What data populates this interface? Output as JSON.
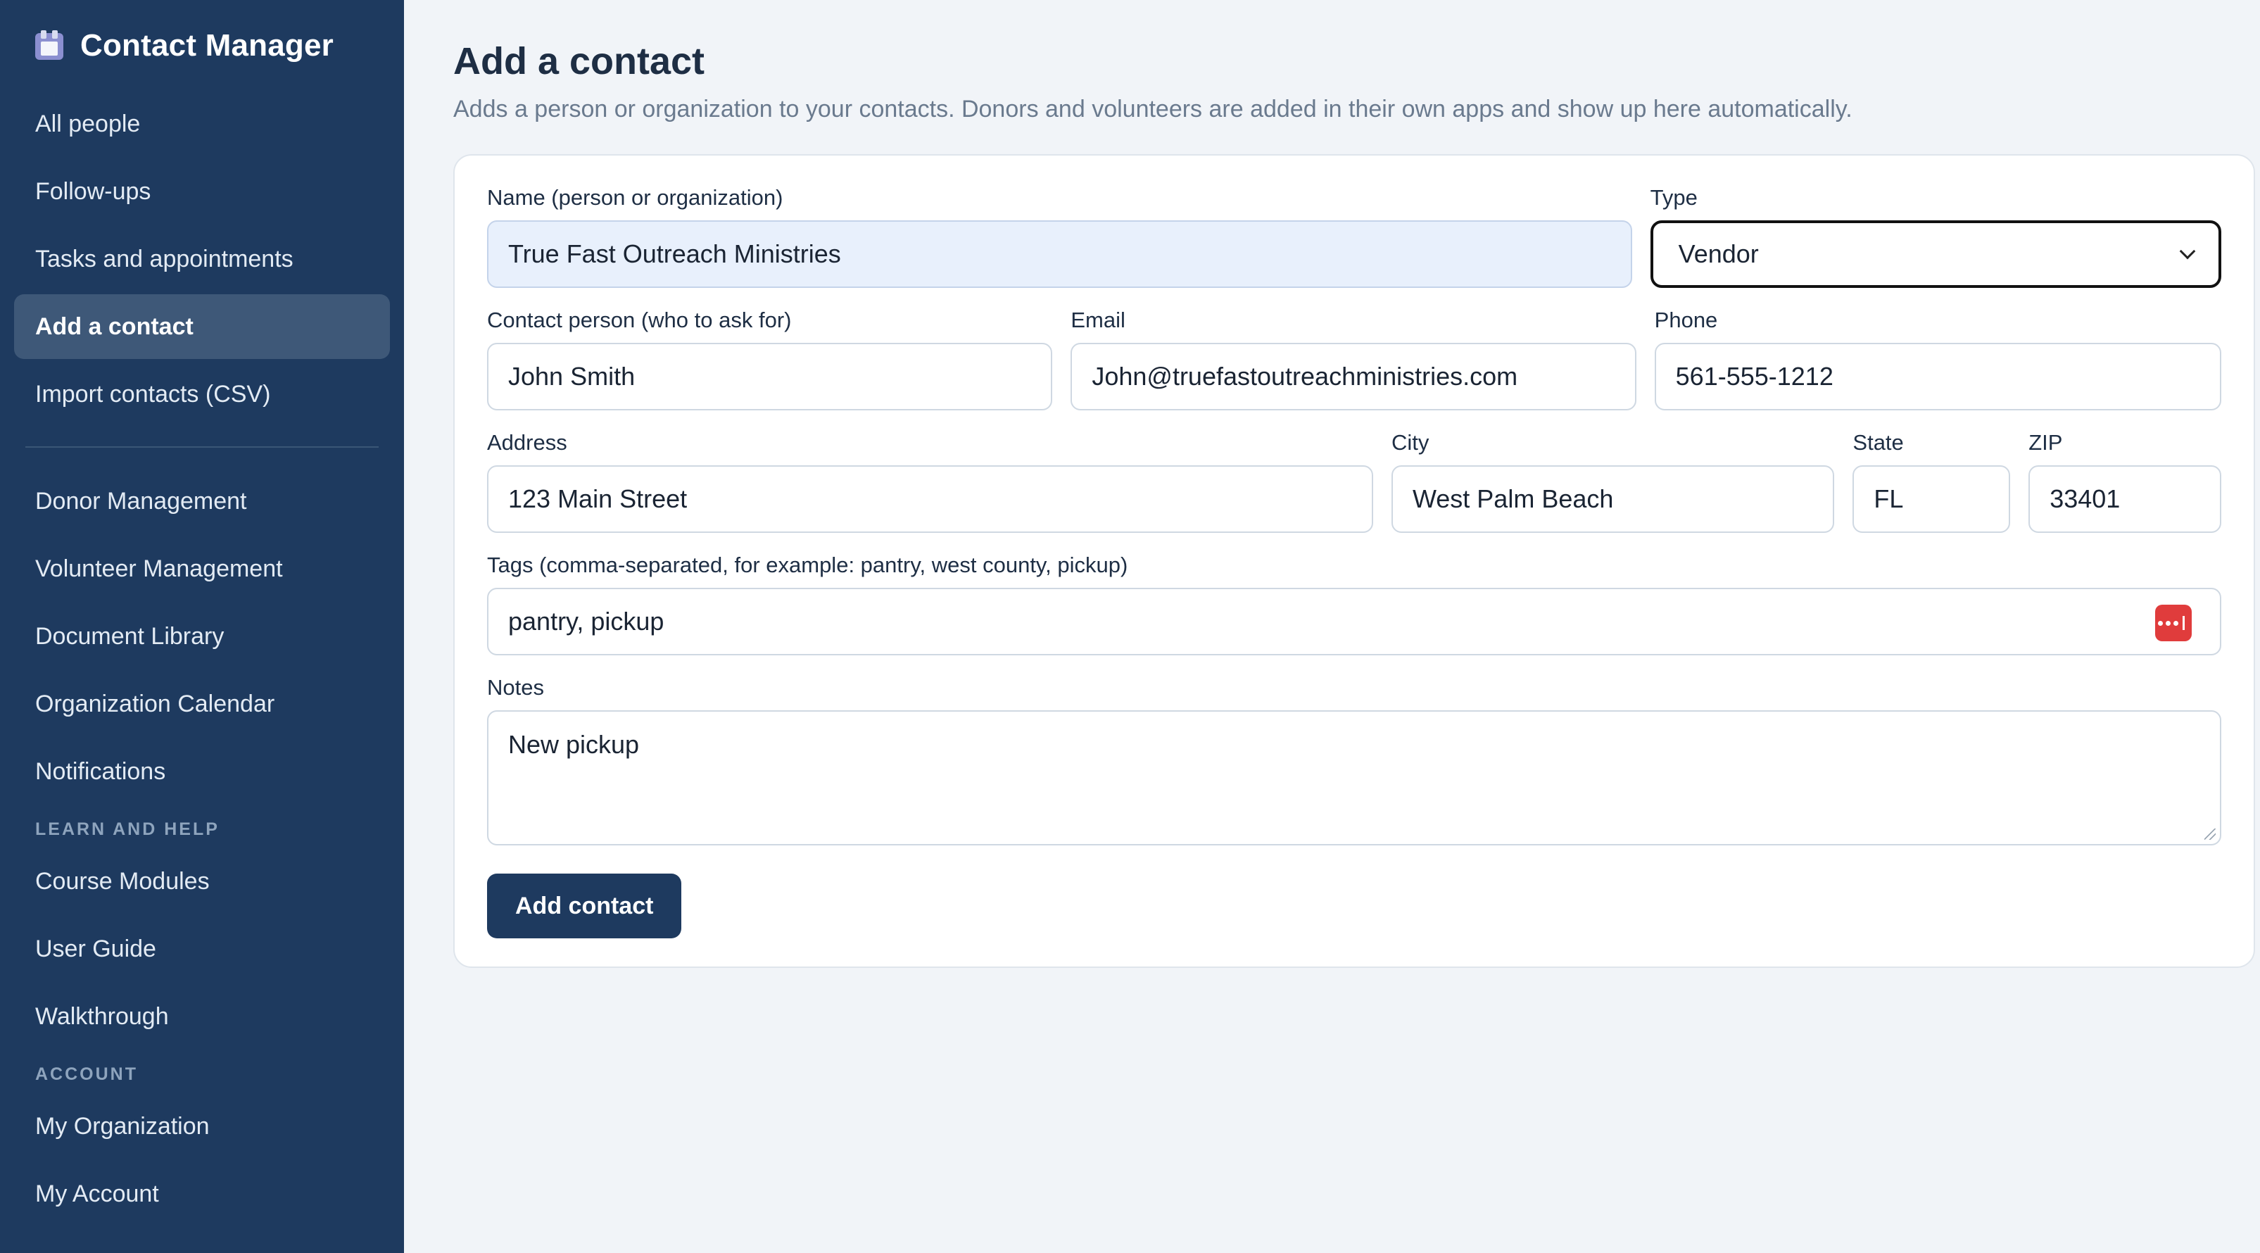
{
  "app": {
    "title": "Contact Manager"
  },
  "sidebar": {
    "primary_items": [
      {
        "label": "All people"
      },
      {
        "label": "Follow-ups"
      },
      {
        "label": "Tasks and appointments"
      },
      {
        "label": "Add a contact",
        "active": true
      },
      {
        "label": "Import contacts (CSV)"
      }
    ],
    "secondary_items": [
      {
        "label": "Donor Management"
      },
      {
        "label": "Volunteer Management"
      },
      {
        "label": "Document Library"
      },
      {
        "label": "Organization Calendar"
      },
      {
        "label": "Notifications"
      }
    ],
    "learn_section": {
      "heading": "LEARN AND HELP",
      "items": [
        {
          "label": "Course Modules"
        },
        {
          "label": "User Guide"
        },
        {
          "label": "Walkthrough"
        }
      ]
    },
    "account_section": {
      "heading": "ACCOUNT",
      "items": [
        {
          "label": "My Organization"
        },
        {
          "label": "My Account"
        }
      ]
    }
  },
  "page": {
    "title": "Add a contact",
    "subtitle": "Adds a person or organization to your contacts. Donors and volunteers are added in their own apps and show up here automatically."
  },
  "form": {
    "name": {
      "label": "Name (person or organization)",
      "value": "True Fast Outreach Ministries"
    },
    "type": {
      "label": "Type",
      "value": "Vendor"
    },
    "contact_person": {
      "label": "Contact person (who to ask for)",
      "value": "John Smith"
    },
    "email": {
      "label": "Email",
      "value": "John@truefastoutreachministries.com"
    },
    "phone": {
      "label": "Phone",
      "value": "561-555-1212"
    },
    "address": {
      "label": "Address",
      "value": "123 Main Street"
    },
    "city": {
      "label": "City",
      "value": "West Palm Beach"
    },
    "state": {
      "label": "State",
      "value": "FL"
    },
    "zip": {
      "label": "ZIP",
      "value": "33401"
    },
    "tags": {
      "label": "Tags (comma-separated, for example: pantry, west county, pickup)",
      "value": "pantry, pickup"
    },
    "notes": {
      "label": "Notes",
      "value": "New pickup"
    },
    "submit_label": "Add contact"
  },
  "icons": {
    "brand": "contact-book-icon",
    "tags_action": "more-dots-icon"
  },
  "colors": {
    "sidebar_bg": "#1e3a5f",
    "active_item_bg": "#3e5878",
    "primary_button": "#1e3a5f",
    "tags_icon": "#e03c3c"
  }
}
